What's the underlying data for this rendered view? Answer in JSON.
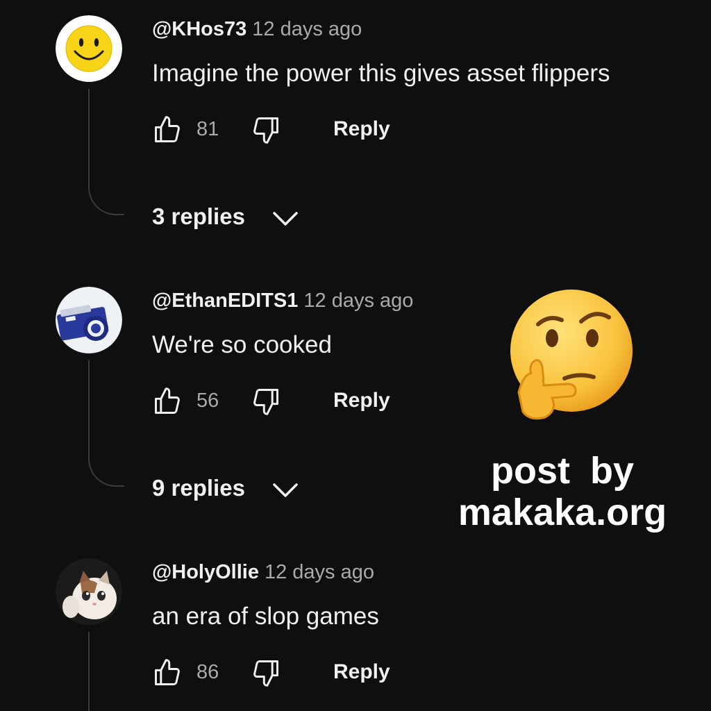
{
  "comments": [
    {
      "handle": "@KHos73",
      "time": "12 days ago",
      "text": "Imagine the power this gives asset flippers",
      "likes": "81",
      "reply_label": "Reply",
      "replies_label": "3 replies",
      "avatar": "smiley-face-icon"
    },
    {
      "handle": "@EthanEDITS1",
      "time": "12 days ago",
      "text": "We're so cooked",
      "likes": "56",
      "reply_label": "Reply",
      "replies_label": "9 replies",
      "avatar": "camera-icon"
    },
    {
      "handle": "@HolyOllie",
      "time": "12 days ago",
      "text": "an era of slop games",
      "likes": "86",
      "reply_label": "Reply",
      "avatar": "crying-cat-thumbs-up"
    }
  ],
  "watermark": {
    "line1": "post by",
    "line2": "makaka.org",
    "emoji": "thinking-face-icon"
  },
  "colors": {
    "background": "#0f0f0f",
    "text_primary": "#f1f1f1",
    "text_secondary": "#aaaaaa",
    "thread_line": "#3a3a3a"
  }
}
